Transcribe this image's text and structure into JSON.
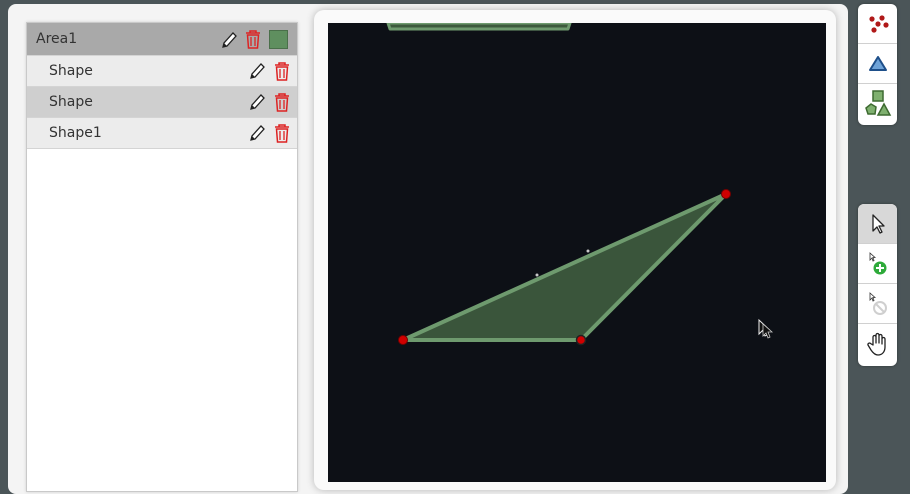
{
  "layers": {
    "area": {
      "name": "Area1",
      "color": "#5f8f5f"
    },
    "shapes": [
      {
        "name": "Shape",
        "selected": false
      },
      {
        "name": "Shape",
        "selected": true
      },
      {
        "name": "Shape1",
        "selected": false
      }
    ]
  },
  "canvas": {
    "background": "#0d1016",
    "polygon_fill": "#3d5a3d",
    "polygon_stroke": "#6e9a6e",
    "vertex_color": "#d00000"
  },
  "toolbar_shapes": {
    "tools": [
      {
        "icon": "points-icon"
      },
      {
        "icon": "triangle-icon"
      },
      {
        "icon": "shapes-icon"
      }
    ]
  },
  "toolbar_modes": {
    "tools": [
      {
        "icon": "pointer-icon",
        "active": true
      },
      {
        "icon": "add-point-icon",
        "active": false
      },
      {
        "icon": "remove-point-icon",
        "active": false
      },
      {
        "icon": "pan-hand-icon",
        "active": false
      }
    ]
  }
}
